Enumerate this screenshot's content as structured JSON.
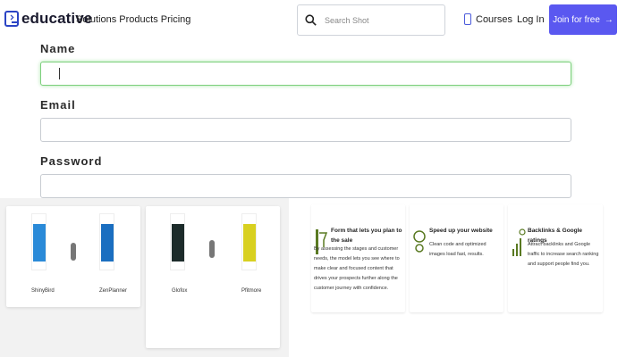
{
  "header": {
    "logo_text": "educative",
    "nav_links": "Solutions Products Pricing",
    "search_placeholder": "Search Shot",
    "courses_label": "Courses",
    "login_label": "Log In",
    "join_label": "Join for free",
    "join_arrow": "→",
    "accent_color": "#5a58f0"
  },
  "form": {
    "name_label": "Name",
    "email_label": "Email",
    "password_label": "Password",
    "name_value": "",
    "email_value": "",
    "password_value": ""
  },
  "cards": {
    "card1": {
      "left_caption": "ShinyBird",
      "vs": "vs",
      "right_caption": "ZenPlanner"
    },
    "card2": {
      "left_caption": "Glofox",
      "vs": "vs",
      "right_caption": "Pfitmore"
    },
    "features": [
      {
        "title": "Form that lets you plan to the sale",
        "text": "By assessing the stages and customer needs, the model lets you see where to make clear and focused content that drives your prospects further along the customer journey with confidence."
      },
      {
        "title": "Speed up your website",
        "text": "Clean code and optimized images load fast, results."
      },
      {
        "title": "Backlinks & Google ratings",
        "text": "Attract backlinks and Google traffic to increase search ranking and support people find you."
      }
    ]
  }
}
